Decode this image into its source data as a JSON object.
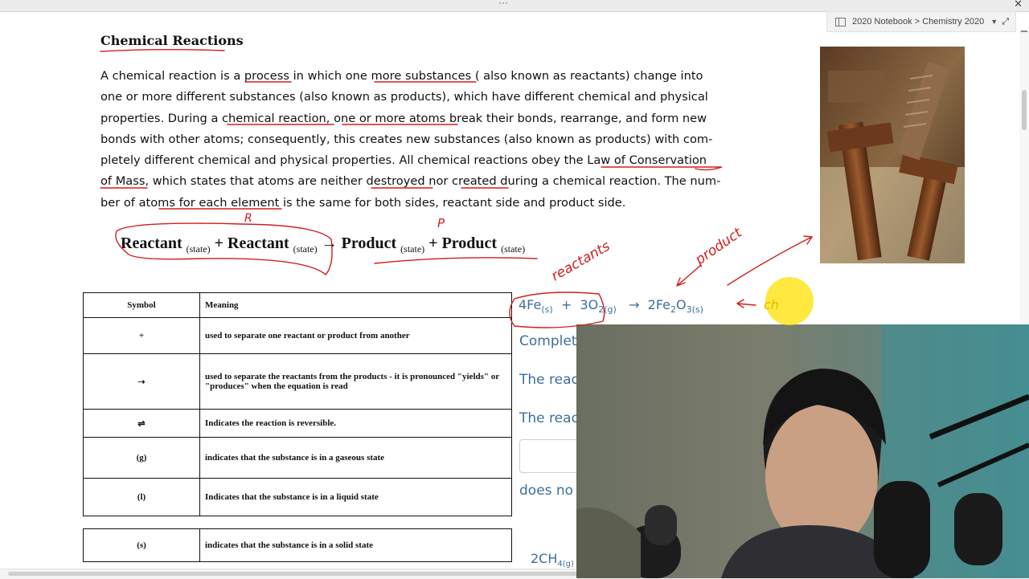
{
  "app": {
    "window_menu_glyph": "···",
    "close_glyph": "✕",
    "breadcrumb": "2020 Notebook > Chemistry 2020",
    "breadcrumb_chevron": "▼",
    "expand_glyph": "⤢"
  },
  "document": {
    "title": "Chemical Reactions",
    "paragraph_lines": [
      "A chemical reaction is a process in which one more substances ( also known as reactants)  change  into",
      "one or more different substances (also known as products), which have different chemical and physical",
      "properties.  During a chemical reaction, one or more atoms break their bonds, rearrange, and form new",
      "bonds with other atoms; consequently, this creates new substances (also known as products) with com-",
      "pletely different chemical and physical properties.  All chemical reactions obey the Law of Conservation",
      "of Mass, which states that atoms are neither destroyed nor created during a chemical reaction. The num-",
      "ber of atoms for each element is the same for both sides, reactant side and product side."
    ],
    "general_equation": {
      "reactant1": "Reactant",
      "state1": "(state)",
      "plus1": "+",
      "reactant2": "Reactant",
      "state2": "(state)",
      "arrow": "→",
      "product1": "Product",
      "state3": "(state)",
      "plus2": "+",
      "product2": "Product",
      "state4": "(state)"
    },
    "symbol_table": {
      "headers": [
        "Symbol",
        "Meaning"
      ],
      "rows": [
        {
          "symbol": "+",
          "meaning": "used to separate one reactant or product from another"
        },
        {
          "symbol": "➝",
          "meaning": "used to separate the reactants from the products - it is pronounced \"yields\" or \"produces\" when the equation is read"
        },
        {
          "symbol": "⇌",
          "meaning": "Indicates the reaction is reversible."
        },
        {
          "symbol": "(g)",
          "meaning": "indicates that the substance is in a gaseous state"
        },
        {
          "symbol": "(l)",
          "meaning": "Indicates that the substance is in a liquid state"
        },
        {
          "symbol": "(s)",
          "meaning": "indicates that the substance is in a solid state"
        }
      ]
    },
    "example_equation": {
      "r1": "4Fe",
      "r1_state": "(s)",
      "plus": "+",
      "r2": "3O",
      "r2_sub": "2",
      "r2_state": "(g)",
      "arrow": "→",
      "p1": "2Fe",
      "p1_sub": "2",
      "p1_o": "O",
      "p1_sub2": "3",
      "p1_state": "(s)"
    },
    "question_fragments": [
      "Complet",
      "The reac",
      "The reac",
      "does no"
    ],
    "ch4_fragment": {
      "text": "2CH",
      "sub": "4(g)"
    }
  },
  "annotations": {
    "r_mark": "R",
    "p_mark": "P",
    "reactants_label": "reactants",
    "product_label": "product",
    "ch_label": "ch"
  },
  "colors": {
    "ink_red": "#d21e1e",
    "text_blue": "#3d6e9e",
    "highlighter": "#ffe000"
  }
}
